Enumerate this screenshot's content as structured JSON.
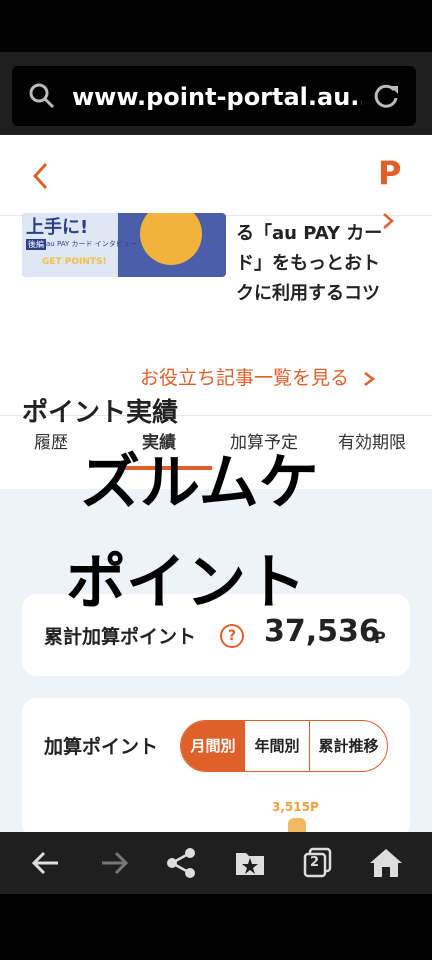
{
  "browser": {
    "url": "www.point-portal.au..."
  },
  "app_header": {
    "logo": "P"
  },
  "article": {
    "banner_title": "上手に!",
    "banner_tag": "後編",
    "banner_sub": "au PAY カード インタビュー",
    "banner_badge": "GET POINTS!",
    "text": "る「au PAY カード」をもっとおトクに利用するコツ",
    "more_link": "お役立ち記事一覧を見る"
  },
  "tabs": [
    {
      "label": "履歴"
    },
    {
      "label": "実績"
    },
    {
      "label": "加算予定"
    },
    {
      "label": "有効期限"
    }
  ],
  "section": {
    "title": "ポイント実績"
  },
  "total": {
    "label": "累計加算ポイント",
    "help": "?",
    "value": "37,536",
    "unit": "P"
  },
  "added": {
    "label": "加算ポイント",
    "toggle": [
      "月間別",
      "年間別",
      "累計推移"
    ],
    "selected": "月間別",
    "bar_label": "3,515P"
  },
  "overlay": {
    "line1": "ズルムケ",
    "line2": "ポイント"
  },
  "colors": {
    "accent": "#e0602a",
    "bar": "#f4b860"
  },
  "nav": [
    "back-icon",
    "forward-icon",
    "share-icon",
    "bookmarks-icon",
    "tabs-icon",
    "home-icon"
  ],
  "nav_tab_count": "2"
}
